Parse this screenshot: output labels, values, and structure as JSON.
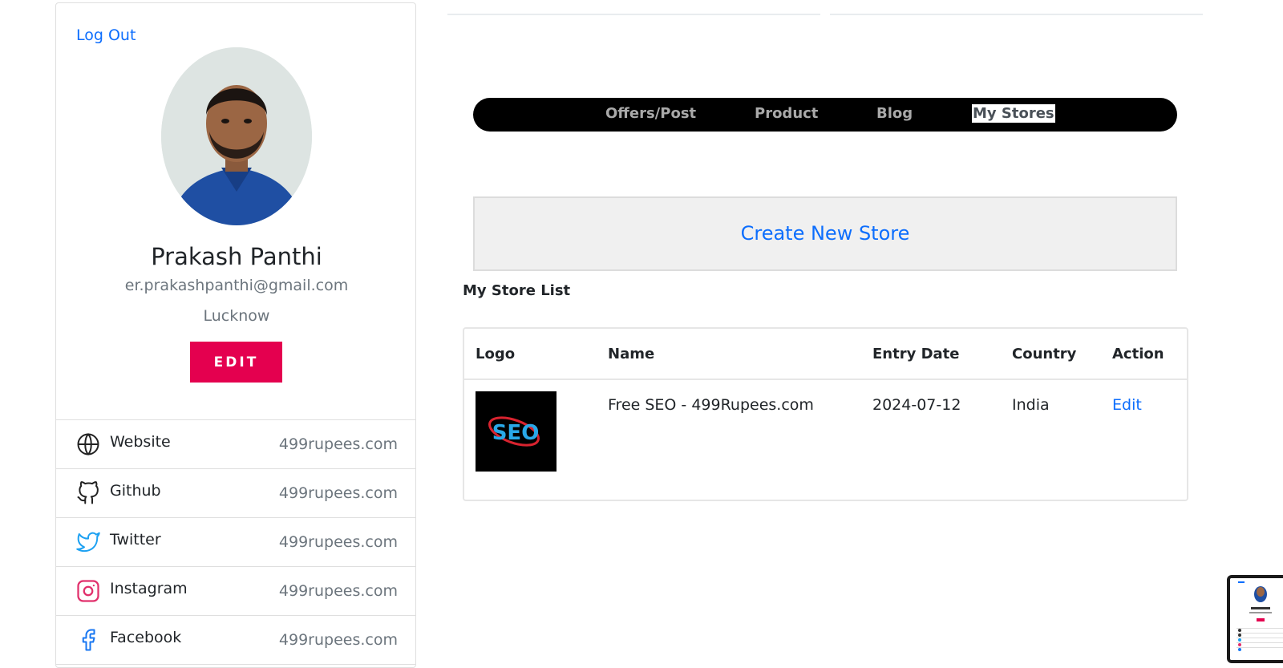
{
  "profile": {
    "logout_label": "Log Out",
    "name": "Prakash Panthi",
    "email": "er.prakashpanthi@gmail.com",
    "city": "Lucknow",
    "edit_label": "EDIT"
  },
  "social": [
    {
      "label": "Website",
      "value": "499rupees.com",
      "icon": "globe-icon"
    },
    {
      "label": "Github",
      "value": "499rupees.com",
      "icon": "github-icon"
    },
    {
      "label": "Twitter",
      "value": "499rupees.com",
      "icon": "twitter-icon"
    },
    {
      "label": "Instagram",
      "value": "499rupees.com",
      "icon": "instagram-icon"
    },
    {
      "label": "Facebook",
      "value": "499rupees.com",
      "icon": "facebook-icon"
    }
  ],
  "nav": {
    "items": [
      "Offers/Post",
      "Product",
      "Blog",
      "My Stores"
    ],
    "active": "My Stores"
  },
  "create_store_label": "Create New Store",
  "store_list": {
    "heading": "My Store List",
    "columns": [
      "Logo",
      "Name",
      "Entry Date",
      "Country",
      "Action"
    ],
    "rows": [
      {
        "logo_text": "SEO",
        "name": "Free SEO - 499Rupees.com",
        "entry_date": "2024-07-12",
        "country": "India",
        "action": "Edit"
      }
    ]
  },
  "colors": {
    "accent_link": "#0d6efd",
    "edit_button": "#e4004f",
    "nav_bar": "#000000",
    "twitter": "#1da1f2",
    "instagram": "#e1306c",
    "facebook": "#1877f2"
  }
}
